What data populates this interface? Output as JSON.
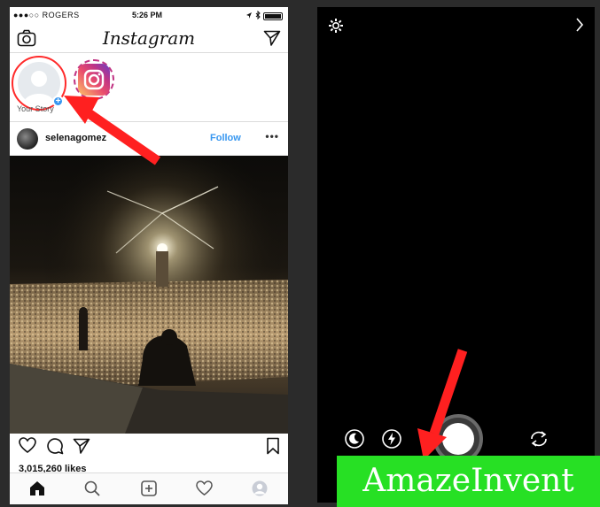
{
  "status_bar": {
    "carrier": "●●●○○ ROGERS",
    "time": "5:26 PM"
  },
  "header": {
    "logo_text": "Instagram"
  },
  "stories": {
    "your_story_label": "Your Story",
    "second_story_label": ""
  },
  "post": {
    "username": "selenagomez",
    "follow_label": "Follow",
    "more_label": "•••",
    "likes": "3,015,260 likes"
  },
  "watermark": {
    "text": "AmazeInvent"
  },
  "colors": {
    "brand_blue": "#3897f0",
    "arrow_red": "#ff2020",
    "watermark_green": "#27e024",
    "story_ring": "#ff2a2a"
  },
  "icons": {
    "top_left": "camera-icon",
    "top_right": "direct-send-icon",
    "action_bar": [
      "heart-icon",
      "comment-icon",
      "send-icon",
      "bookmark-icon"
    ],
    "tab_bar": [
      "home-icon",
      "search-icon",
      "add-post-icon",
      "activity-heart-icon",
      "profile-icon"
    ],
    "camera_screen": [
      "settings-gear-icon",
      "chevron-right-icon",
      "night-mode-icon",
      "flash-icon",
      "shutter-button",
      "switch-camera-icon"
    ]
  }
}
